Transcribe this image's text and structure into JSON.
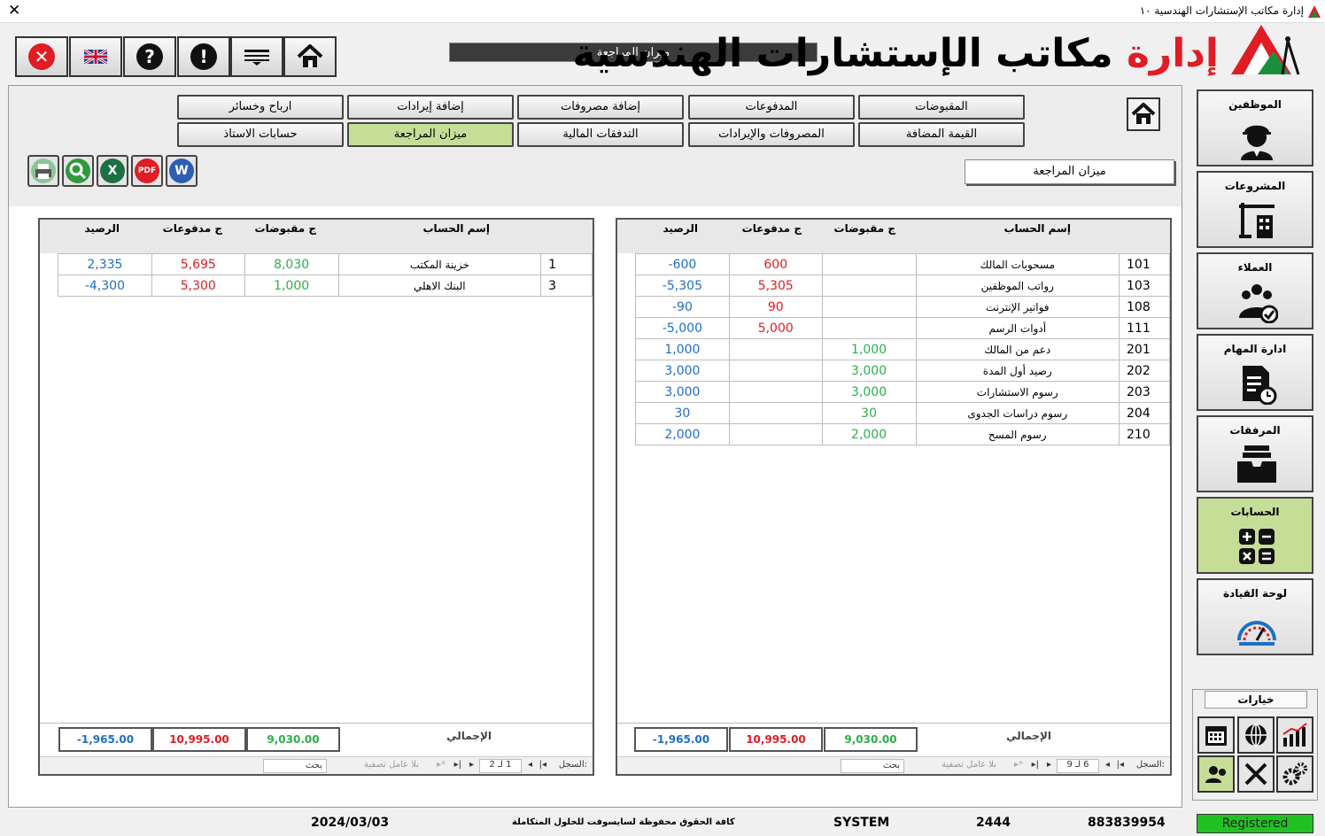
{
  "window": {
    "title": "إدارة مكاتب الإستشارات الهندسية ١٠",
    "close_glyph": "✕"
  },
  "toolbar": {
    "form_name": "ميزان المراجعة",
    "lang_label": "EN"
  },
  "logo": {
    "part1": "إدارة ",
    "part2": "مكاتب الإستشارات الهندسية"
  },
  "nav": {
    "row1": [
      "المقبوضات",
      "المدفوعات",
      "إضافة مصروفات",
      "إضافة إيرادات",
      "ارباح وخسائر"
    ],
    "row2": [
      "القيمة المضافة",
      "المصروفات والإيرادات",
      "التدفقات المالية",
      "ميزان المراجعة",
      "حسابات الاستاذ"
    ],
    "active": "ميزان المراجعة"
  },
  "subtitle": "ميزان المراجعة",
  "export": {
    "pdf": "PDF",
    "excel": "X",
    "word": "W"
  },
  "grid_right": {
    "headers": {
      "name": "إسم الحساب",
      "receipts": "ج مقبوضات",
      "payments": "ج مدفوعات",
      "balance": "الرصيد"
    },
    "rows": [
      {
        "acct": "101",
        "name": "مسحوبات المالك",
        "receipts": "",
        "payments": "600",
        "balance": "-600"
      },
      {
        "acct": "103",
        "name": "رواتب الموظفين",
        "receipts": "",
        "payments": "5,305",
        "balance": "-5,305"
      },
      {
        "acct": "108",
        "name": "فواتير الإنترنت",
        "receipts": "",
        "payments": "90",
        "balance": "-90"
      },
      {
        "acct": "111",
        "name": "أدوات الرسم",
        "receipts": "",
        "payments": "5,000",
        "balance": "-5,000"
      },
      {
        "acct": "201",
        "name": "دعم من المالك",
        "receipts": "1,000",
        "payments": "",
        "balance": "1,000"
      },
      {
        "acct": "202",
        "name": "رصيد أول المدة",
        "receipts": "3,000",
        "payments": "",
        "balance": "3,000"
      },
      {
        "acct": "203",
        "name": "رسوم الاستشارات",
        "receipts": "3,000",
        "payments": "",
        "balance": "3,000"
      },
      {
        "acct": "204",
        "name": "رسوم دراسات الجدوى",
        "receipts": "30",
        "payments": "",
        "balance": "30"
      },
      {
        "acct": "210",
        "name": "رسوم المسح",
        "receipts": "2,000",
        "payments": "",
        "balance": "2,000"
      }
    ],
    "totals": {
      "label": "الإجمالي",
      "receipts": "9,030.00",
      "payments": "10,995.00",
      "balance": "-1,965.00"
    },
    "navigator": {
      "record_label": "السجل:",
      "position": "6 لـ 9",
      "filter": "بلا عامل تصفية",
      "search": "بحث"
    }
  },
  "grid_left": {
    "headers": {
      "name": "إسم الحساب",
      "receipts": "ج مقبوضات",
      "payments": "ج مدفوعات",
      "balance": "الرصيد"
    },
    "rows": [
      {
        "acct": "1",
        "name": "خزينة المكتب",
        "receipts": "8,030",
        "payments": "5,695",
        "balance": "2,335"
      },
      {
        "acct": "3",
        "name": "البنك الاهلي",
        "receipts": "1,000",
        "payments": "5,300",
        "balance": "-4,300"
      }
    ],
    "totals": {
      "label": "الإجمالي",
      "receipts": "9,030.00",
      "payments": "10,995.00",
      "balance": "-1,965.00"
    },
    "navigator": {
      "record_label": "السجل:",
      "position": "1 لـ 2",
      "filter": "بلا عامل تصفية",
      "search": "بحث"
    }
  },
  "side_menu": [
    {
      "label": "الموظفين",
      "icon": "engineer-icon"
    },
    {
      "label": "المشروعات",
      "icon": "crane-icon"
    },
    {
      "label": "العملاء",
      "icon": "clients-icon"
    },
    {
      "label": "ادارة المهام",
      "icon": "task-icon"
    },
    {
      "label": "المرفقات",
      "icon": "inbox-icon"
    },
    {
      "label": "الحسابات",
      "icon": "calculator-icon"
    },
    {
      "label": "لوحة القيادة",
      "icon": "gauge-icon"
    }
  ],
  "side_active": "الحسابات",
  "options": {
    "label": "خيارات"
  },
  "status": {
    "date": "2024/03/03",
    "copyright": "كافة الحقوق محفوظة لسايسوفت للحلول المتكاملة",
    "user": "SYSTEM",
    "code": "2444",
    "phone": "883839954",
    "registered": "Registered"
  },
  "colors": {
    "accent_active": "#c6dd98",
    "receipts": "#2cae4a",
    "payments": "#e01c24",
    "balance": "#1f6fc4",
    "registered": "#22c122"
  }
}
